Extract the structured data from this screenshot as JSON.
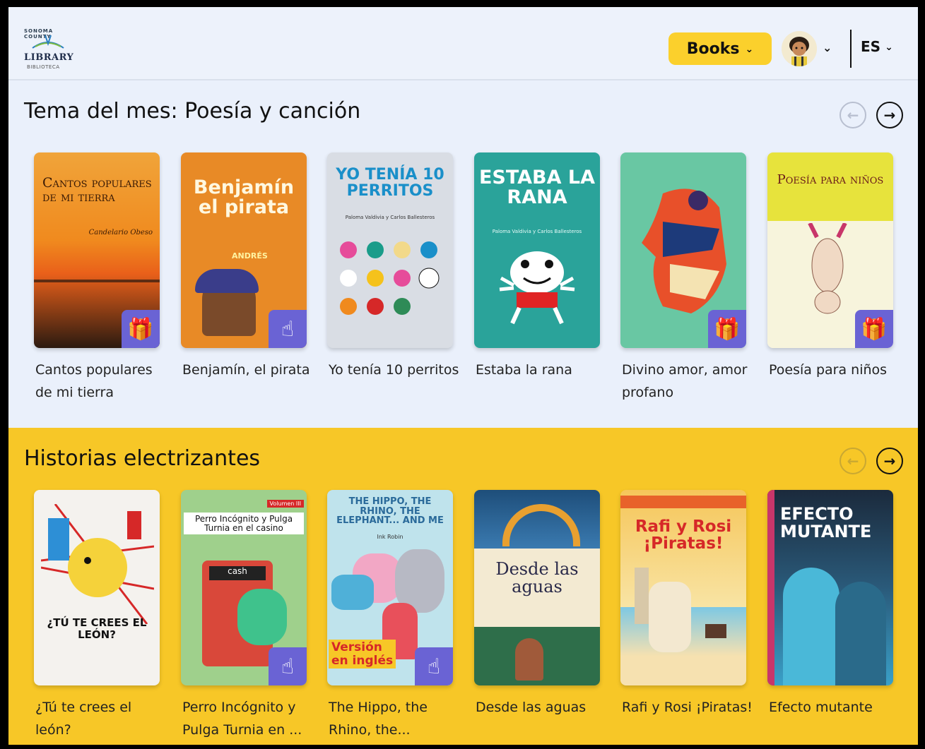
{
  "header": {
    "logo_top": "SONOMA COUNTY",
    "logo_word": "LIBRARY",
    "logo_sub": "BIBLIOTECA",
    "books_label": "Books",
    "lang_label": "ES"
  },
  "section1": {
    "title": "Tema del mes: Poesía y canción",
    "books": [
      {
        "title": "Cantos populares de mi tierra",
        "cover_text": "Cantos populares de mi tierra",
        "cover_author": "Candelario Obeso",
        "badge": "gift-icon"
      },
      {
        "title": "Benjamín, el pirata",
        "cover_text": "Benjamín el pirata",
        "cover_author": "ANDRÉS",
        "badge": "tap-icon"
      },
      {
        "title": "Yo tenía 10 perritos",
        "cover_text": "YO TENÍA 10 PERRITOS",
        "cover_author": "Paloma Valdivia y Carlos Ballesteros",
        "badge": ""
      },
      {
        "title": "Estaba la rana",
        "cover_text": "ESTABA LA RANA",
        "cover_author": "Paloma Valdivia y Carlos Ballesteros",
        "badge": ""
      },
      {
        "title": "Divino amor, amor profano",
        "cover_text": "",
        "cover_author": "",
        "badge": "gift-icon"
      },
      {
        "title": "Poesía para niños",
        "cover_text": "Poesía para niños",
        "cover_author": "",
        "badge": "gift-icon"
      }
    ]
  },
  "section2": {
    "title": "Historias electrizantes",
    "books": [
      {
        "title": "¿Tú te crees el león?",
        "cover_text": "¿TÚ TE CREES EL LEÓN?",
        "cover_author": "",
        "badge": ""
      },
      {
        "title": "Perro Incógnito y Pulga Turnia en ...",
        "cover_text": "Perro Incógnito y Pulga Turnia en el casino",
        "cover_author": "Volumen III",
        "badge": "tap-icon"
      },
      {
        "title": "The Hippo, the Rhino, the...",
        "cover_text": "THE HIPPO, THE RHINO, THE ELEPHANT... AND ME",
        "cover_author": "Ink Robin",
        "badge": "tap-icon"
      },
      {
        "title": "Desde las aguas",
        "cover_text": "Desde las aguas",
        "cover_author": "",
        "badge": ""
      },
      {
        "title": "Rafi y Rosi ¡Piratas!",
        "cover_text": "Rafi y Rosi ¡Piratas!",
        "cover_author": "",
        "badge": ""
      },
      {
        "title": "Efecto mutante",
        "cover_text": "EFECTO MUTANTE",
        "cover_author": "",
        "badge": ""
      }
    ]
  },
  "colors": {
    "accent_yellow": "#fbd02c",
    "badge_purple": "#6a63d4",
    "background": "#eaf0fb"
  }
}
